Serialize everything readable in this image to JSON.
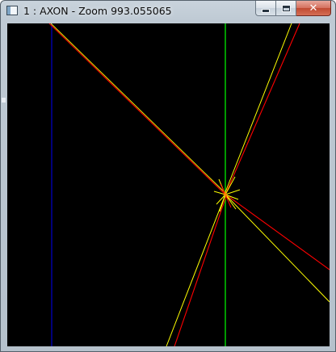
{
  "window": {
    "title": "1 : AXON - Zoom 993.055065",
    "app_icon": "window-app-icon",
    "buttons": {
      "minimize_icon": "minimize-icon",
      "maximize_icon": "maximize-icon",
      "close_icon": "close-icon",
      "close_glyph": "✕"
    }
  },
  "canvas": {
    "background": "#000000",
    "colors": {
      "blue_axis": "#0000cc",
      "green_axis": "#00ff00",
      "red_segments": "#ff0000",
      "yellow_segments": "#ffff00",
      "orange_overlap": "#ff8800"
    }
  }
}
